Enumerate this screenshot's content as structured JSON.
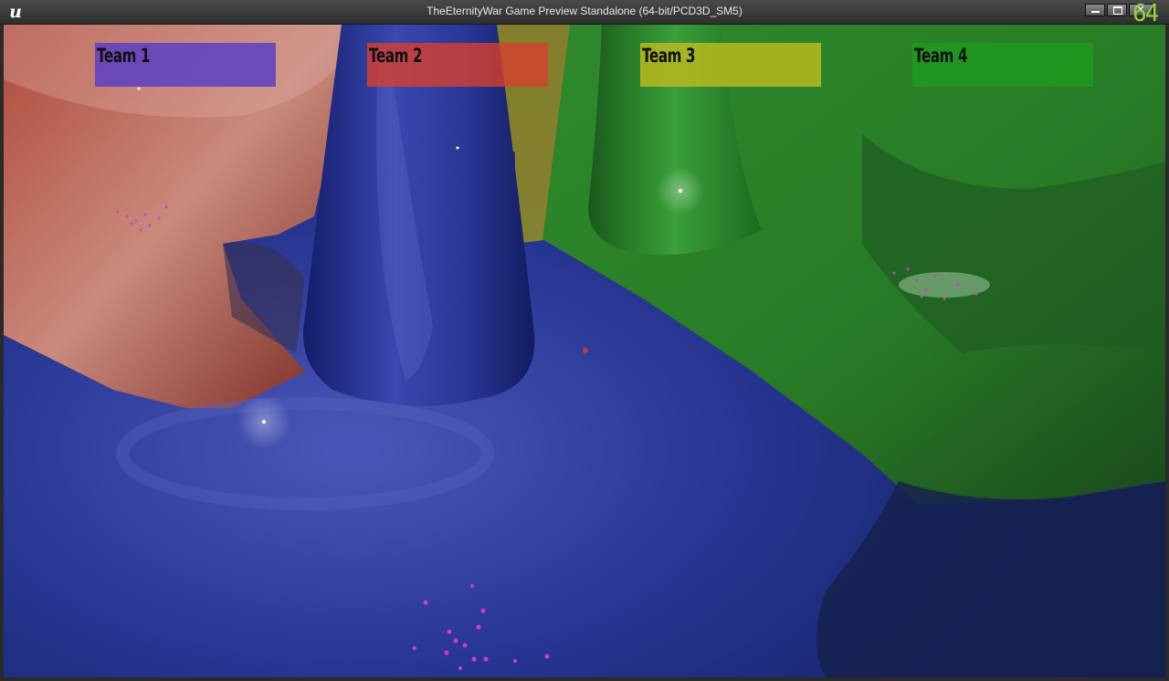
{
  "window": {
    "title": "TheEternityWar Game Preview Standalone (64-bit/PCD3D_SM5)",
    "logo_icon": "unreal-engine-logo",
    "controls": {
      "minimize_icon": "minimize-icon",
      "maximize_icon": "maximize-icon",
      "close_icon": "close-icon",
      "close_glyph": "✕"
    },
    "fps": "64"
  },
  "hud": {
    "teams": [
      {
        "label": "Team 1",
        "color": "#5a3fc4"
      },
      {
        "label": "Team 2",
        "color": "#d8402e"
      },
      {
        "label": "Team 3",
        "color": "#b8b81e"
      },
      {
        "label": "Team 4",
        "color": "#1f9a1f"
      }
    ]
  },
  "scene": {
    "colors": {
      "blue_floor": "#1c2a8c",
      "blue_cone": "#27339a",
      "red_region": "#a8402e",
      "green_region": "#2b8a2a",
      "yellow_region": "#a89a28",
      "particles": "#d23ad8"
    }
  }
}
